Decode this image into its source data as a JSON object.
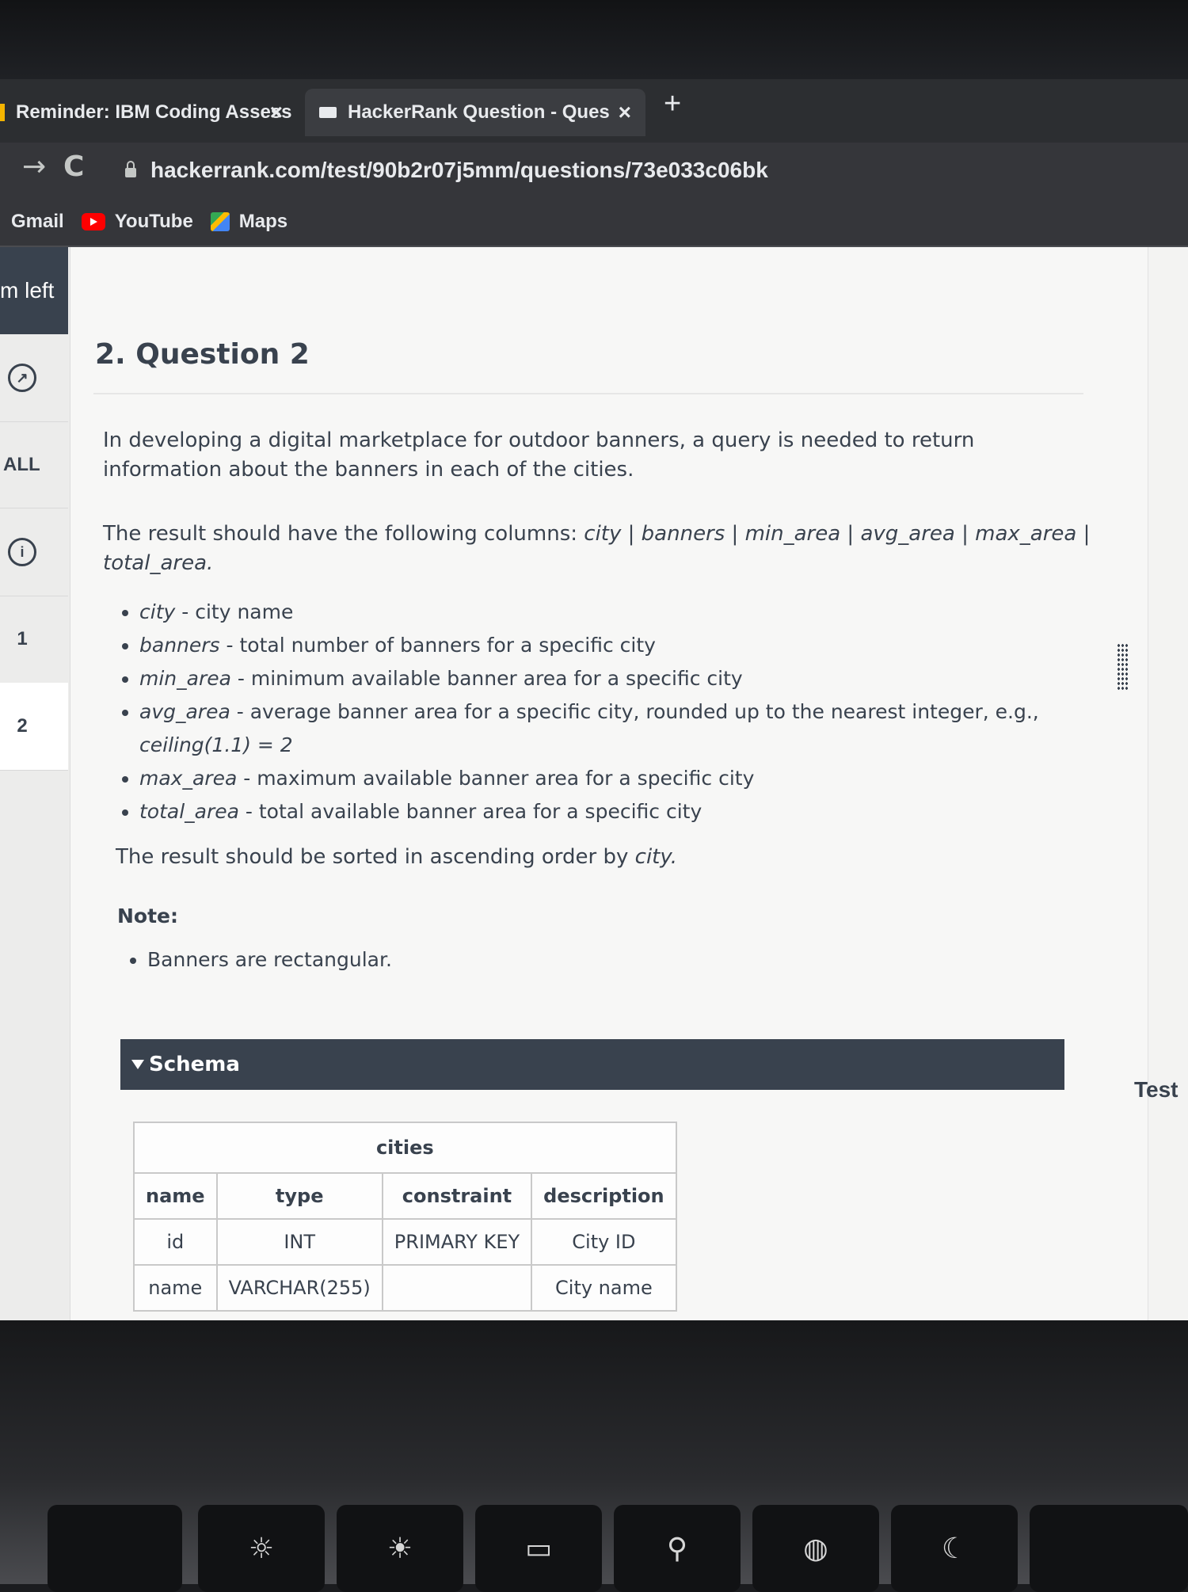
{
  "browser": {
    "tabs": [
      {
        "title": "Reminder: IBM Coding Assess",
        "close": "×"
      },
      {
        "title": "HackerRank Question - Questi",
        "close": "×"
      }
    ],
    "new_tab": "+",
    "nav": {
      "forward": "→",
      "reload": "C"
    },
    "url": "hackerrank.com/test/90b2r07j5mm/questions/73e033c06bk",
    "bookmarks": [
      "Gmail",
      "YouTube",
      "Maps"
    ]
  },
  "sidebar": {
    "time_left": "m left",
    "all_label": "ALL",
    "questions": [
      "1",
      "2"
    ]
  },
  "question": {
    "title": "2. Question 2",
    "intro": "In developing a digital marketplace for outdoor banners, a query is needed to return information about the banners in each of the cities.",
    "columns_prefix": "The result should have the following columns: ",
    "columns_list": "city | banners | min_area | avg_area | max_area | total_area.",
    "definitions": [
      {
        "term": "city",
        "desc": " - city name"
      },
      {
        "term": "banners",
        "desc": " - total number of banners for a specific city"
      },
      {
        "term": "min_area",
        "desc": " - minimum available banner area for a specific city"
      },
      {
        "term": "avg_area",
        "desc": " - average banner area for a specific city, rounded up to the nearest integer, e.g., ",
        "extra": "ceiling(1.1) = 2"
      },
      {
        "term": "max_area",
        "desc": " - maximum available banner area for a specific city"
      },
      {
        "term": "total_area",
        "desc": " - total available banner area for a specific city"
      }
    ],
    "sort_prefix": "The result should be sorted in ascending order by ",
    "sort_term": "city.",
    "note_label": "Note:",
    "notes": [
      "Banners are rectangular."
    ],
    "schema_label": "Schema",
    "table": {
      "caption": "cities",
      "headers": [
        "name",
        "type",
        "constraint",
        "description"
      ],
      "rows": [
        [
          "id",
          "INT",
          "PRIMARY KEY",
          "City ID"
        ],
        [
          "name",
          "VARCHAR(255)",
          "",
          "City name"
        ]
      ]
    }
  },
  "footer": {
    "test_button": "Test"
  },
  "colors": {
    "header_dark": "#39424e",
    "page_bg": "#f7f7f6",
    "chrome_bg": "#35363a"
  }
}
